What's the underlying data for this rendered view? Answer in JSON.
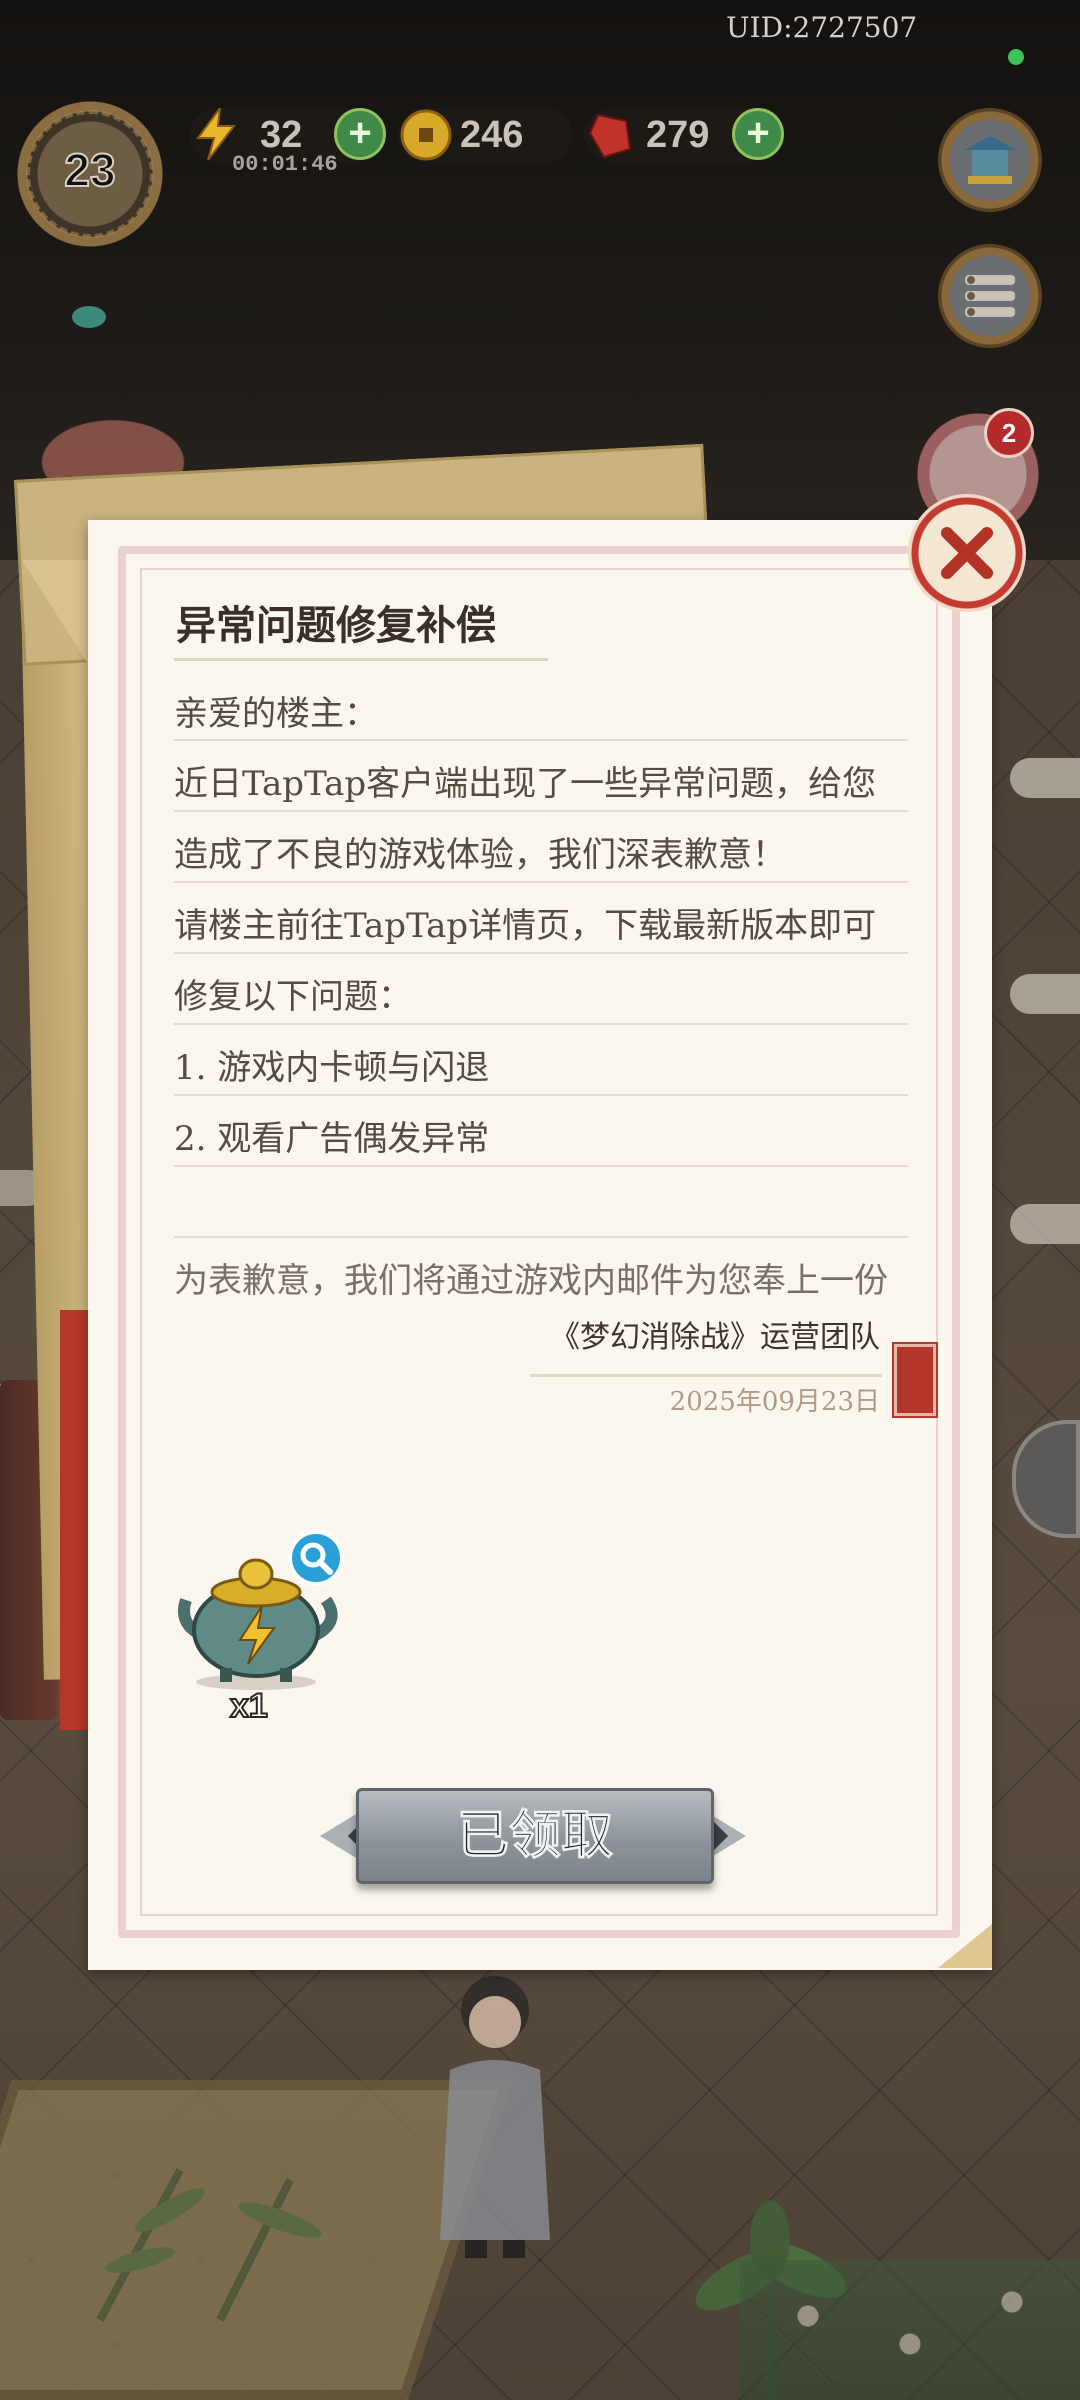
{
  "hud": {
    "uid": "UID:2727507",
    "level": "23",
    "energy": "32",
    "energy_timer": "00:01:46",
    "coins": "246",
    "gems": "279"
  },
  "mail": {
    "title": "异常问题修复补偿",
    "lines": [
      "亲爱的楼主：",
      "近日TapTap客户端出现了一些异常问题，给您",
      "造成了不良的游戏体验，我们深表歉意！",
      "请楼主前往TapTap详情页，下载最新版本即可",
      "修复以下问题：",
      "1. 游戏内卡顿与闪退",
      "2. 观看广告偶发异常",
      "",
      "为表歉意，我们将通过游戏内邮件为您奉上一份"
    ],
    "signature": "《梦幻消除战》运营团队",
    "date": "2025年09月23日",
    "reward": {
      "item": "teapot-energy",
      "count": "x1"
    },
    "claim_button": "已领取"
  },
  "background": {
    "rabbit_badge": "2"
  },
  "colors": {
    "accent_red": "#b4352a",
    "paper": "#fbf6ee",
    "button_gray": "#8e959a"
  }
}
